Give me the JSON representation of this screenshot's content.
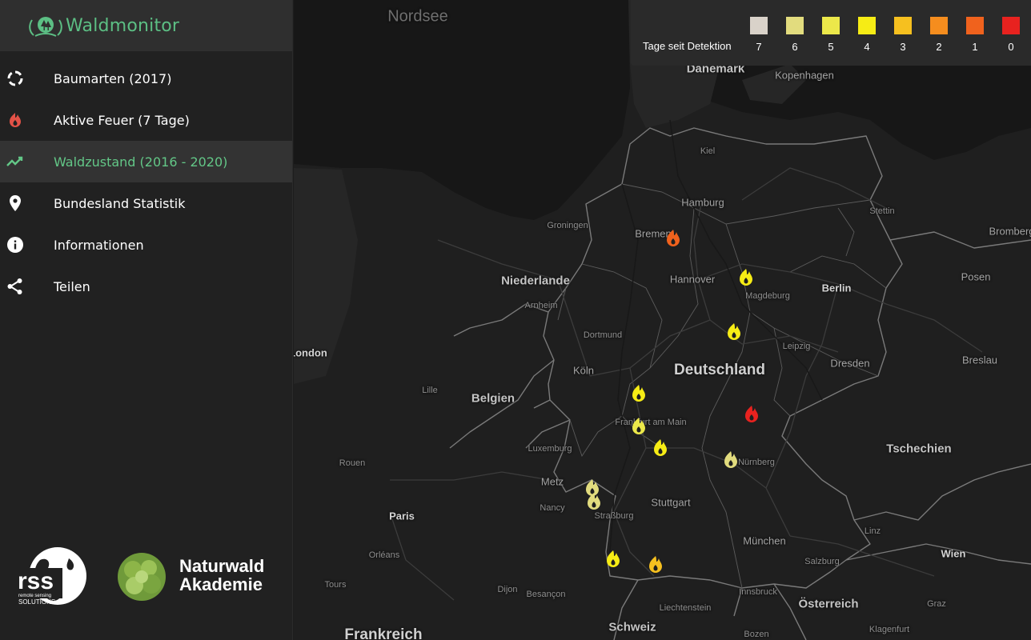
{
  "app": {
    "title": "Waldmonitor"
  },
  "nav": {
    "items": [
      {
        "label": "Baumarten (2017)"
      },
      {
        "label": "Aktive Feuer (7 Tage)"
      },
      {
        "label": "Waldzustand (2016 - 2020)"
      },
      {
        "label": "Bundesland Statistik"
      },
      {
        "label": "Informationen"
      },
      {
        "label": "Teilen"
      }
    ],
    "active_index": 2
  },
  "partners": {
    "rss": {
      "big": "rss",
      "line1": "remote sensing",
      "line2": "SOLUTIONS"
    },
    "naturwald": {
      "line1": "Naturwald",
      "line2": "Akademie"
    }
  },
  "legend": {
    "title": "Tage seit Detektion",
    "items": [
      {
        "value": "7",
        "color": "#d9d2c9"
      },
      {
        "value": "6",
        "color": "#e2dc7e"
      },
      {
        "value": "5",
        "color": "#ece84a"
      },
      {
        "value": "4",
        "color": "#f6ec15"
      },
      {
        "value": "3",
        "color": "#f6c01f"
      },
      {
        "value": "2",
        "color": "#f58d1e"
      },
      {
        "value": "1",
        "color": "#f0621d"
      },
      {
        "value": "0",
        "color": "#e8221f"
      }
    ]
  },
  "map": {
    "labels": {
      "nordsee": "Nordsee",
      "daenemark": "Dänemark",
      "kopenhagen": "Kopenhagen",
      "kiel": "Kiel",
      "hamburg": "Hamburg",
      "stettin": "Stettin",
      "bromberg": "Bromberg",
      "groningen": "Groningen",
      "bremen": "Bremen",
      "niederlande": "Niederlande",
      "hannover": "Hannover",
      "berlin": "Berlin",
      "posen": "Posen",
      "arnheim": "Arnheim",
      "magdeburg": "Magdeburg",
      "london": "London",
      "dortmund": "Dortmund",
      "leipzig": "Leipzig",
      "breslau": "Breslau",
      "deutschland": "Deutschland",
      "dresden": "Dresden",
      "koeln": "Köln",
      "lille": "Lille",
      "belgien": "Belgien",
      "frankfurt": "Frankfurt am Main",
      "tschechien": "Tschechien",
      "luxemburg": "Luxemburg",
      "rouen": "Rouen",
      "nuernberg": "Nürnberg",
      "metz": "Metz",
      "paris": "Paris",
      "nancy": "Nancy",
      "stuttgart": "Stuttgart",
      "strassburg": "Straßburg",
      "linz": "Linz",
      "muenchen": "München",
      "wien": "Wien",
      "orleans": "Orléans",
      "salzburg": "Salzburg",
      "tours": "Tours",
      "dijon": "Dijon",
      "besancon": "Besançon",
      "innsbruck": "Innsbruck",
      "oesterreich": "Österreich",
      "graz": "Graz",
      "liechtenstein": "Liechtenstein",
      "schweiz": "Schweiz",
      "frankreich": "Frankreich",
      "bozen": "Bozen",
      "klagenfurt": "Klagenfurt"
    },
    "fires": [
      {
        "days": 1
      },
      {
        "days": 4
      },
      {
        "days": 4
      },
      {
        "days": 4
      },
      {
        "days": 5
      },
      {
        "days": 4
      },
      {
        "days": 0
      },
      {
        "days": 6
      },
      {
        "days": 6
      },
      {
        "days": 6
      },
      {
        "days": 4
      },
      {
        "days": 3
      }
    ]
  }
}
